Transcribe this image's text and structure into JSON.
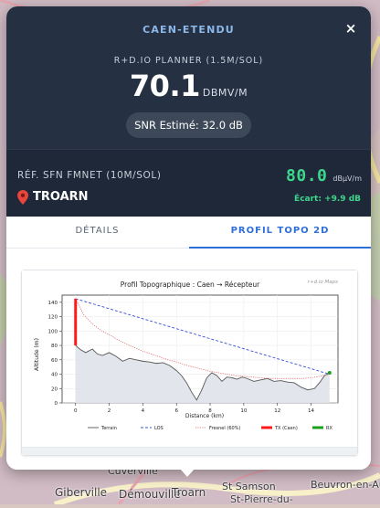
{
  "map": {
    "labels": [
      "Cuverville",
      "Giberville",
      "Démouville",
      "Troarn",
      "St Samson",
      "Beuvron-en-Aug",
      "St-Pierre-du-"
    ]
  },
  "popup": {
    "title": "CAEN-ETENDU",
    "close_icon": "×",
    "source_label": "R+D.IO PLANNER (1.5M/SOL)",
    "main_value": "70.1",
    "main_unit": "DBMV/M",
    "snr_text": "SNR Estimé: 32.0 dB",
    "reference": {
      "label": "RÉF. SFN FMNET (10M/SOL)",
      "city": "TROARN",
      "value": "80.0",
      "unit": "dBµV/m",
      "delta": "Écart: +9.9 dB"
    },
    "tabs": [
      {
        "label": "DÉTAILS",
        "active": false
      },
      {
        "label": "PROFIL TOPO 2D",
        "active": true
      }
    ],
    "colors": {
      "header_bg": "#253142",
      "accent_blue": "#2e6fd8",
      "value_green": "#3dd68c"
    }
  },
  "chart_data": {
    "type": "line",
    "title": "Profil Topographique : Caen → Récepteur",
    "watermark": "r+d.io Maps",
    "xlabel": "Distance (km)",
    "ylabel": "Altitude (m)",
    "xlim": [
      -0.8,
      15.6
    ],
    "ylim": [
      0,
      150
    ],
    "xticks": [
      0,
      2,
      4,
      6,
      8,
      10,
      12,
      14
    ],
    "yticks": [
      0,
      20,
      40,
      60,
      80,
      100,
      120,
      140
    ],
    "grid": true,
    "legend": [
      "Terrain",
      "LOS",
      "Fresnel (60%)",
      "TX (Caen)",
      "RX"
    ],
    "series": [
      {
        "name": "Terrain",
        "x": [
          0,
          0.3,
          0.6,
          1,
          1.3,
          1.6,
          2,
          2.4,
          2.8,
          3.2,
          3.6,
          4,
          4.4,
          4.8,
          5.2,
          5.6,
          6,
          6.3,
          6.6,
          6.9,
          7.2,
          7.5,
          7.8,
          8.1,
          8.4,
          8.7,
          9,
          9.3,
          9.6,
          9.9,
          10.2,
          10.6,
          11,
          11.4,
          11.8,
          12.2,
          12.6,
          13,
          13.4,
          13.8,
          14.2,
          14.5,
          14.8,
          15.1
        ],
        "y": [
          80,
          74,
          70,
          75,
          68,
          66,
          70,
          65,
          58,
          62,
          60,
          58,
          57,
          55,
          56,
          52,
          45,
          38,
          28,
          15,
          4,
          18,
          35,
          42,
          38,
          30,
          36,
          35,
          33,
          36,
          34,
          30,
          32,
          34,
          30,
          31,
          29,
          28,
          22,
          18,
          20,
          28,
          38,
          42
        ]
      },
      {
        "name": "LOS",
        "x": [
          0,
          15.1
        ],
        "y": [
          145,
          40
        ]
      },
      {
        "name": "Fresnel (60%)",
        "x": [
          0,
          0.5,
          1,
          1.5,
          2,
          2.5,
          3,
          3.5,
          4,
          4.5,
          5,
          5.5,
          6,
          6.5,
          7,
          7.5,
          8,
          8.5,
          9,
          9.5,
          10,
          10.5,
          11,
          11.5,
          12,
          12.5,
          13,
          13.5,
          14,
          14.5,
          15.1
        ],
        "y": [
          145,
          122,
          110,
          101,
          95,
          88,
          82,
          77,
          72,
          68,
          64,
          60,
          57,
          53,
          50,
          47,
          44,
          42,
          40,
          38,
          37,
          36,
          35,
          34,
          34,
          34,
          34,
          34,
          35,
          37,
          40
        ]
      },
      {
        "name": "TX (Caen)",
        "x": [
          0,
          0
        ],
        "y": [
          80,
          145
        ]
      },
      {
        "name": "RX",
        "x": [
          15.1
        ],
        "y": [
          42
        ]
      }
    ]
  }
}
